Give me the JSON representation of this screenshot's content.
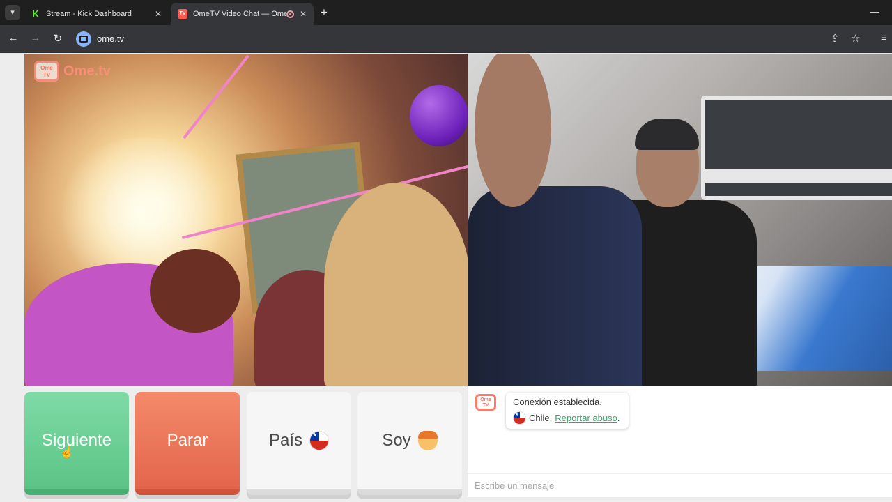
{
  "browser": {
    "tabs": [
      {
        "title": "Stream - Kick Dashboard",
        "close": "✕"
      },
      {
        "title": "OmeTV Video Chat — Ome",
        "close": "✕"
      }
    ],
    "url": "ome.tv",
    "icons": {
      "tab_search": "chevron-down-icon",
      "back": "arrow-left-icon",
      "forward": "arrow-right-icon",
      "reload": "reload-icon",
      "cast": "cast-icon",
      "bookmark": "star-icon"
    }
  },
  "video": {
    "logo_text": "Ome.tv",
    "logo_tv": "Ome TV"
  },
  "buttons": {
    "next": "Siguiente",
    "stop": "Parar",
    "country": "País",
    "gender": "Soy"
  },
  "chat": {
    "logo_tv": "Ome TV",
    "status": "Conexión establecida.",
    "country": "Chile.",
    "report": "Reportar abuso",
    "report_suffix": ".",
    "placeholder": "Escribe un mensaje"
  },
  "colors": {
    "next": "#5bc485",
    "stop": "#e3654a",
    "link": "#36a66a",
    "brand": "#ff6f5e"
  }
}
